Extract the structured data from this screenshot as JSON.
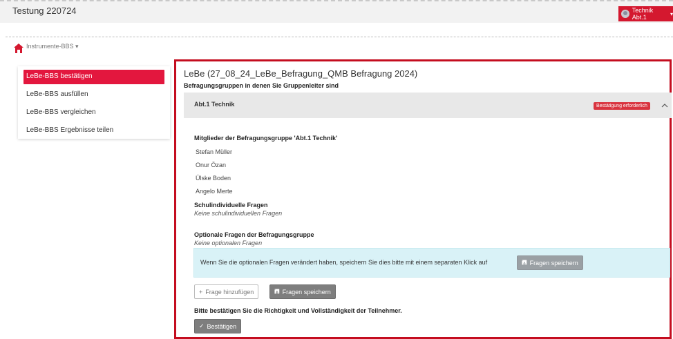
{
  "app": {
    "title": "Testung 220724"
  },
  "user": {
    "label": "Technik Abt.1"
  },
  "breadcrumb": {
    "label": "Instrumente-BBS ▾"
  },
  "sidebar": {
    "items": [
      {
        "label": "LeBe-BBS bestätigen"
      },
      {
        "label": "LeBe-BBS ausfüllen"
      },
      {
        "label": "LeBe-BBS vergleichen"
      },
      {
        "label": "LeBe-BBS Ergebnisse teilen"
      }
    ]
  },
  "main": {
    "title": "LeBe (27_08_24_LeBe_Befragung_QMB Befragung 2024)",
    "subtitle": "Befragungsgruppen in denen Sie Gruppenleiter sind",
    "group": {
      "name": "Abt.1 Technik",
      "badge": "Bestätigung erforderlich"
    },
    "members_heading": "Mitglieder der Befragungsgruppe 'Abt.1 Technik'",
    "members": [
      "Stefan Müller",
      "Onur Özan",
      "Ülske Boden",
      "Angelo Merte"
    ],
    "school_questions": {
      "heading": "Schulindividuelle Fragen",
      "note": "Keine schulindividuellen Fragen"
    },
    "optional_questions": {
      "heading": "Optionale Fragen der Befragungsgruppe",
      "note": "Keine optionalen Fragen"
    },
    "info": {
      "text": "Wenn Sie die optionalen Fragen verändert haben, speichern Sie dies bitte mit einem separaten Klick auf",
      "save_label": "Fragen speichern"
    },
    "buttons": {
      "add_label": "Frage hinzufügen",
      "save_label": "Fragen speichern"
    },
    "confirm": {
      "heading": "Bitte bestätigen Sie die Richtigkeit und Vollständigkeit der Teilnehmer.",
      "button_label": "Bestätigen"
    }
  },
  "icons": {
    "home": "home-icon",
    "save": "floppy-icon",
    "plus": "plus-icon",
    "check": "check-icon",
    "chevron": "chevron-up-icon"
  },
  "colors": {
    "accent": "#e3173e",
    "frame": "#c40d1f",
    "info_bg": "#d9f2f7"
  }
}
